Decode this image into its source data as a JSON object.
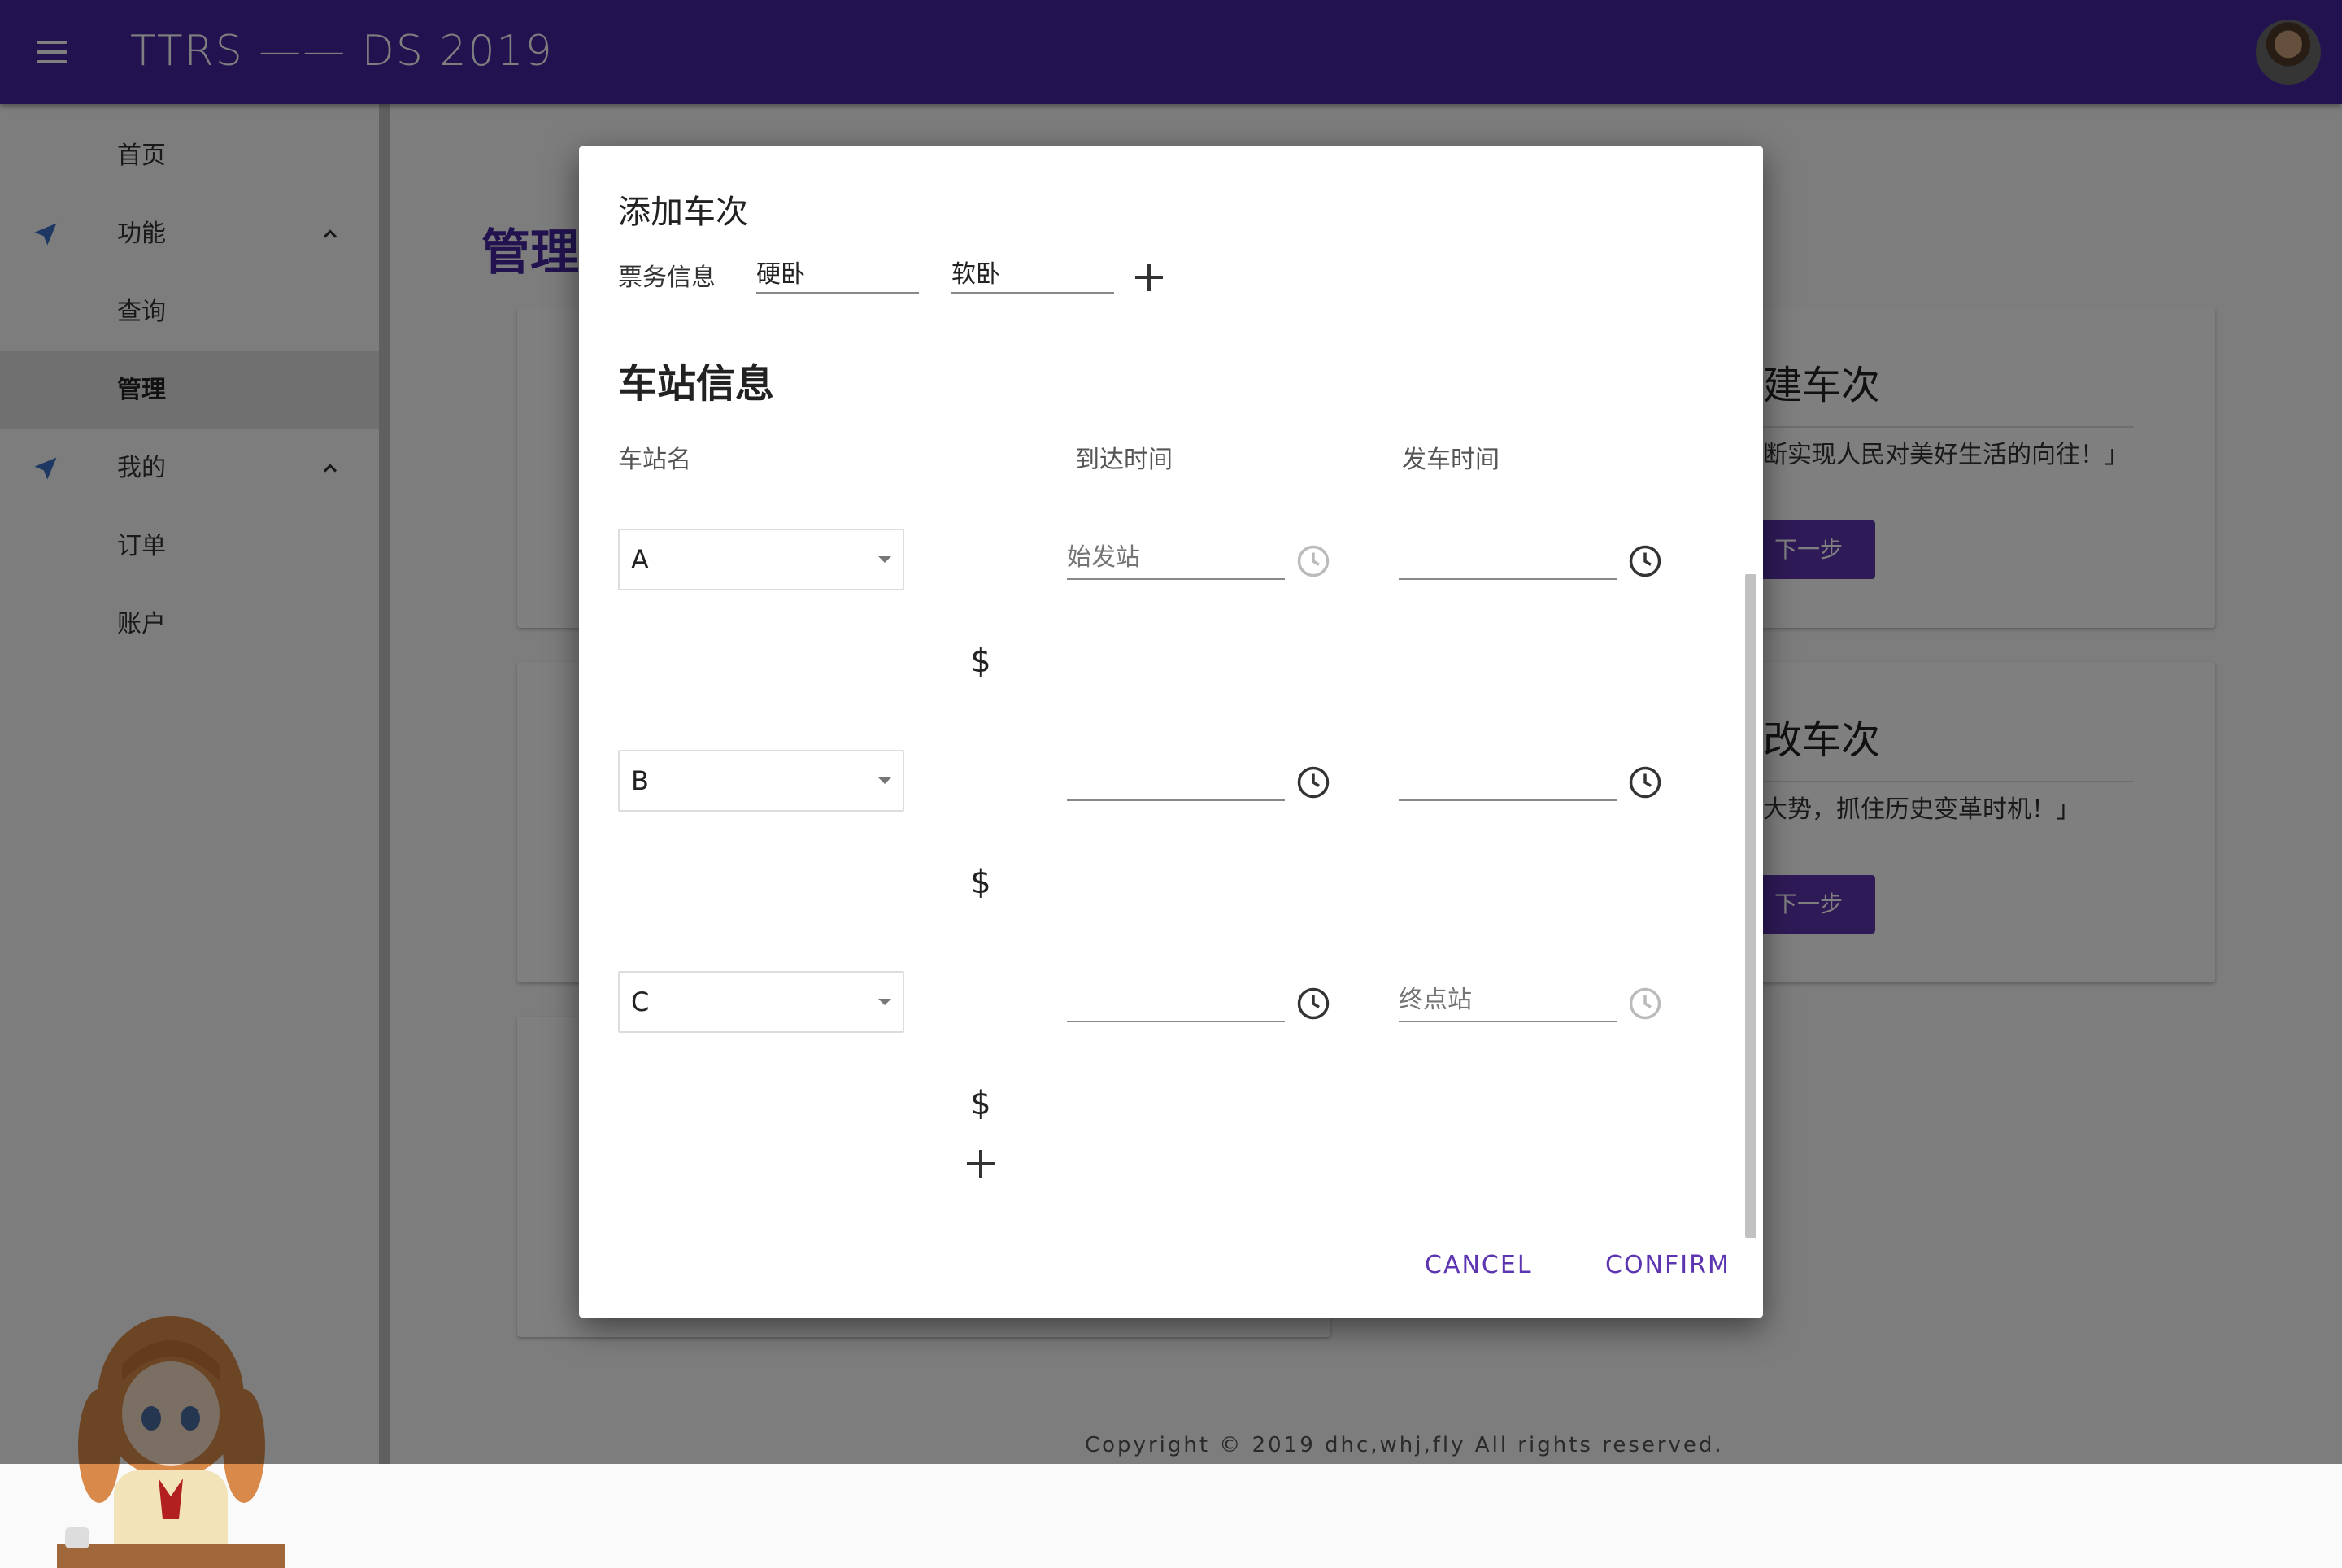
{
  "app": {
    "title": "TTRS —— DS 2019"
  },
  "sidebar": {
    "items": [
      {
        "label": "首页"
      },
      {
        "label": "功能"
      },
      {
        "label": "查询"
      },
      {
        "label": "管理"
      },
      {
        "label": "我的"
      },
      {
        "label": "订单"
      },
      {
        "label": "账户"
      }
    ],
    "active": "管理"
  },
  "main": {
    "title": "管理",
    "cards": [
      {
        "title": "新建车次",
        "title_visible": "建车次",
        "desc": "不断实现人民对美好生活的向往！」",
        "desc_visible": "断实现人民对美好生活的向往！」",
        "button": "下一步"
      },
      {
        "title": "修改车次",
        "title_visible": "改车次",
        "desc": "顺应大势，抓住历史变革时机！」",
        "desc_visible": "大势，抓住历史变革时机！」",
        "button": "下一步"
      }
    ],
    "footer": "Copyright © 2019 dhc,whj,fly All rights reserved."
  },
  "dialog": {
    "title": "添加车次",
    "ticket_label": "票务信息",
    "tickets": [
      "硬卧",
      "软卧"
    ],
    "section_title": "车站信息",
    "columns": {
      "station": "车站名",
      "arrive": "到达时间",
      "depart": "发车时间"
    },
    "stations": [
      {
        "name": "A",
        "arrive": "",
        "arrive_placeholder": "始发站",
        "depart": "",
        "depart_placeholder": ""
      },
      {
        "name": "B",
        "arrive": "",
        "arrive_placeholder": "",
        "depart": "",
        "depart_placeholder": ""
      },
      {
        "name": "C",
        "arrive": "",
        "arrive_placeholder": "",
        "depart": "",
        "depart_placeholder": "终点站"
      }
    ],
    "price_symbol": "$",
    "cancel": "CANCEL",
    "confirm": "CONFIRM"
  },
  "colors": {
    "primary": "#4527a0",
    "accent": "#5e35b1",
    "nav_icon": "#3f6fc6"
  }
}
